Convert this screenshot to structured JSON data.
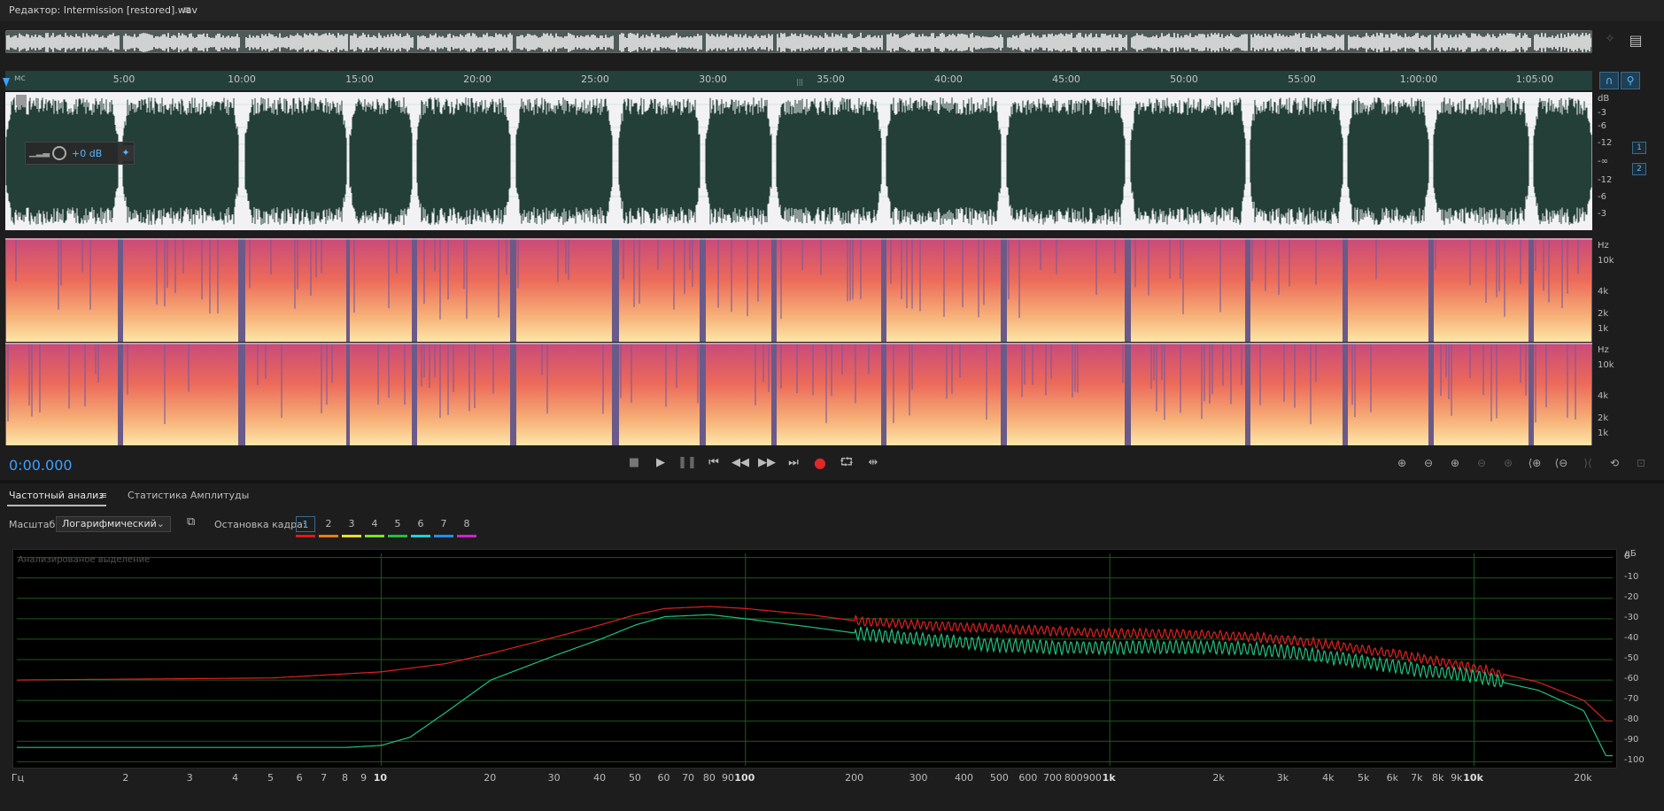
{
  "window": {
    "title": "Редактор: Intermission [restored].wav",
    "menu_icon": "hamburger-icon"
  },
  "ruler": {
    "unit": "мс",
    "ticks": [
      "5:00",
      "10:00",
      "15:00",
      "20:00",
      "25:00",
      "30:00",
      "35:00",
      "40:00",
      "45:00",
      "50:00",
      "55:00",
      "1:00:00",
      "1:05:00"
    ]
  },
  "waveform": {
    "scale_labels": [
      "dB",
      "-3",
      "-6",
      "-12",
      "-∞",
      "-12",
      "-6",
      "-3"
    ],
    "hud_gain": "+0 dB",
    "channels": [
      "1",
      "2"
    ]
  },
  "spectrogram": {
    "labels": [
      "Hz",
      "10k",
      "4k",
      "2k",
      "1k"
    ]
  },
  "transport": {
    "timecode": "0:00.000",
    "buttons": [
      "stop-icon",
      "play-icon",
      "pause-icon",
      "goto-start-icon",
      "rewind-icon",
      "fast-forward-icon",
      "goto-end-icon",
      "record-icon",
      "loop-icon",
      "skip-selection-icon"
    ]
  },
  "panel": {
    "tabs": [
      "Частотный анализ",
      "Статистика Амплитуды"
    ],
    "scale_label": "Масштаб:",
    "scale_value": "Логарифмический",
    "freeze_label": "Остановка кадра:",
    "freeze_slots": [
      "1",
      "2",
      "3",
      "4",
      "5",
      "6",
      "7",
      "8"
    ],
    "freeze_colors": [
      "#e01818",
      "#ef7a10",
      "#e8e020",
      "#80e020",
      "#20c040",
      "#20d0d8",
      "#2090f0",
      "#d020d0"
    ]
  },
  "analysis": {
    "title": "Анализированое выделение",
    "db_unit": "дБ",
    "db_ticks": [
      "0",
      "-10",
      "-20",
      "-30",
      "-40",
      "-50",
      "-60",
      "-70",
      "-80",
      "-90",
      "-100"
    ],
    "freq_unit": "Гц",
    "freq_ticks": [
      "2",
      "3",
      "4",
      "5",
      "6",
      "7",
      "8",
      "9",
      "10",
      "20",
      "30",
      "40",
      "50",
      "60",
      "70",
      "80",
      "90",
      "100",
      "200",
      "300",
      "400",
      "500",
      "600",
      "700",
      "800",
      "900",
      "1k",
      "2k",
      "3k",
      "4k",
      "5k",
      "6k",
      "7k",
      "8k",
      "9k",
      "10k",
      "20k"
    ]
  },
  "chart_data": {
    "type": "line",
    "xlabel": "Гц",
    "ylabel": "дБ",
    "xscale": "log",
    "xlim": [
      1,
      24000
    ],
    "ylim": [
      -102,
      2
    ],
    "series": [
      {
        "color": "#e02020",
        "x": [
          1,
          5,
          10,
          15,
          20,
          30,
          40,
          50,
          60,
          80,
          100,
          150,
          200,
          300,
          500,
          700,
          1000,
          2000,
          3000,
          5000,
          7000,
          10000,
          15000,
          20000,
          23000
        ],
        "y": [
          -60,
          -59,
          -56,
          -52,
          -47,
          -39,
          -33,
          -28,
          -25,
          -24,
          -25,
          -28,
          -31,
          -33,
          -35,
          -36,
          -37,
          -38,
          -40,
          -45,
          -49,
          -54,
          -61,
          -70,
          -80
        ]
      },
      {
        "color": "#20c080",
        "x": [
          1,
          5,
          8,
          10,
          12,
          15,
          20,
          30,
          40,
          50,
          60,
          80,
          100,
          150,
          200,
          300,
          500,
          700,
          1000,
          2000,
          3000,
          5000,
          7000,
          10000,
          15000,
          20000,
          23000
        ],
        "y": [
          -93,
          -93,
          -93,
          -92,
          -88,
          -76,
          -60,
          -48,
          -40,
          -33,
          -29,
          -28,
          -30,
          -34,
          -37,
          -40,
          -43,
          -44,
          -44,
          -44,
          -46,
          -51,
          -55,
          -58,
          -65,
          -75,
          -97
        ]
      }
    ]
  }
}
